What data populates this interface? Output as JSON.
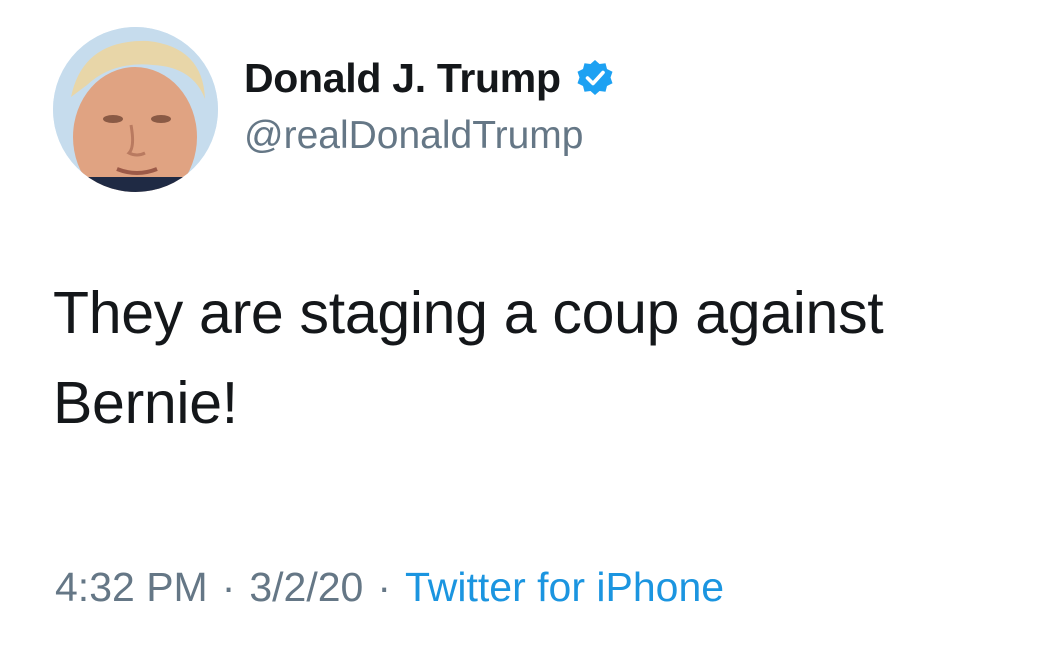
{
  "author": {
    "display_name": "Donald J. Trump",
    "handle": "@realDonaldTrump",
    "verified": true,
    "avatar_icon": "profile-photo"
  },
  "tweet": {
    "text": "They are staging a coup against Bernie!"
  },
  "meta": {
    "time": "4:32 PM",
    "separator": "·",
    "date": "3/2/20",
    "source": "Twitter for iPhone"
  },
  "colors": {
    "text": "#14171a",
    "secondary": "#657786",
    "link": "#1b95e0",
    "verified": "#1da1f2"
  }
}
